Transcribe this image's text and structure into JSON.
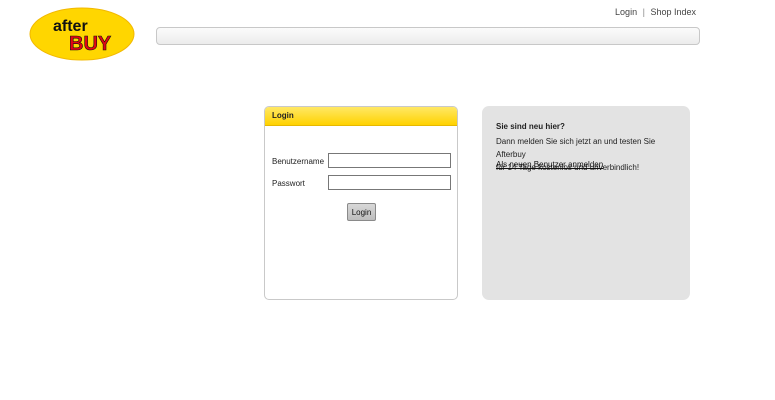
{
  "brand": {
    "logo_top": "after",
    "logo_bottom": "BUY",
    "colors": {
      "yellow": "#ffd600",
      "red": "#e30613",
      "bar": "#ececec"
    }
  },
  "header": {
    "links": [
      {
        "label": "Login"
      },
      {
        "label": "Shop Index"
      }
    ],
    "separator": "|"
  },
  "login_panel": {
    "title": "Login",
    "username_label": "Benutzername",
    "username_value": "",
    "password_label": "Passwort",
    "password_value": "",
    "submit_label": "Login"
  },
  "info_panel": {
    "title": "Sie sind neu hier?",
    "line1": "Dann melden Sie sich jetzt an und testen Sie Afterbuy",
    "line2": "für 14 Tage kostenlos und unverbindlich!",
    "link": "Als neuen Benutzer anmelden"
  }
}
